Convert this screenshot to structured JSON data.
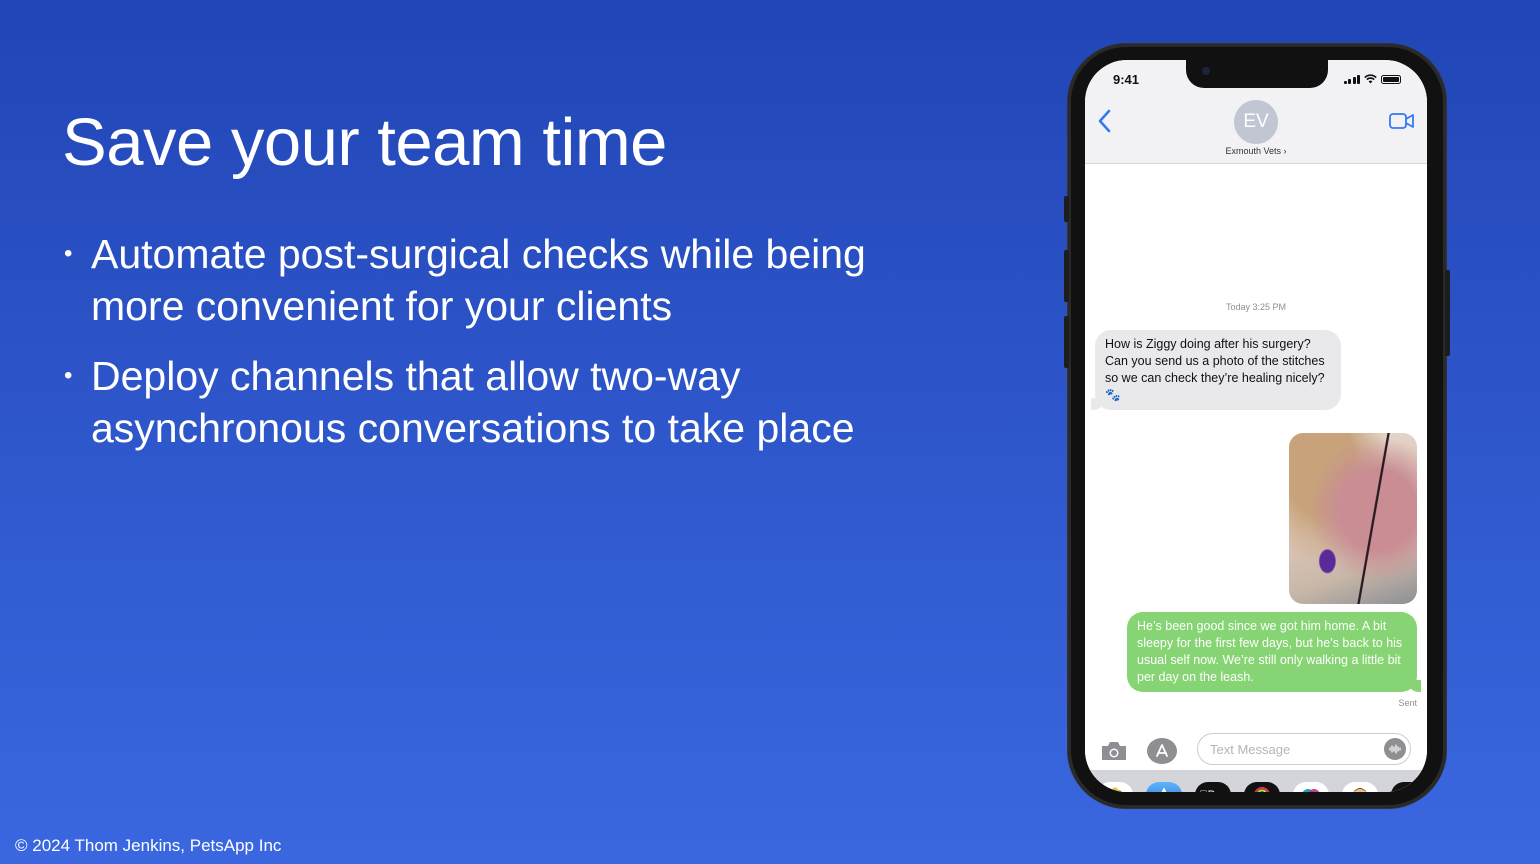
{
  "slide": {
    "title": "Save your team time",
    "bullets": [
      "Automate post-surgical checks while being more convenient for your clients",
      "Deploy channels that allow two-way asynchronous conversations to take place"
    ],
    "bullet_glyph": "•",
    "footer": "© 2024 Thom Jenkins, PetsApp Inc"
  },
  "phone": {
    "status_time": "9:41",
    "contact": {
      "initials": "EV",
      "name": "Exmouth Vets ›"
    },
    "timestamp": "Today 3:25 PM",
    "messages": [
      {
        "direction": "incoming",
        "text": "How is Ziggy doing after his surgery? Can you send us a photo of the stitches so we can check they’re healing nicely? 🐾"
      },
      {
        "direction": "outgoing",
        "type": "photo",
        "description": "photo of dog's stitched surgical wound"
      },
      {
        "direction": "outgoing",
        "text": "He’s been good since we got him home. A bit sleepy for the first few days, but he’s back to his usual self now. We’re still only walking a little bit per day on the leash."
      }
    ],
    "delivery_status": "Sent",
    "input_placeholder": "Text Message",
    "tray_apps": [
      "photos-app",
      "app-store",
      "apple-pay",
      "activity",
      "digital-touch",
      "memoji",
      "heart-stickers"
    ],
    "apple_pay_label": "Pay",
    "colors": {
      "incoming_bubble": "#e9e9eb",
      "outgoing_bubble": "#86d474",
      "accent": "#3478f6"
    }
  }
}
